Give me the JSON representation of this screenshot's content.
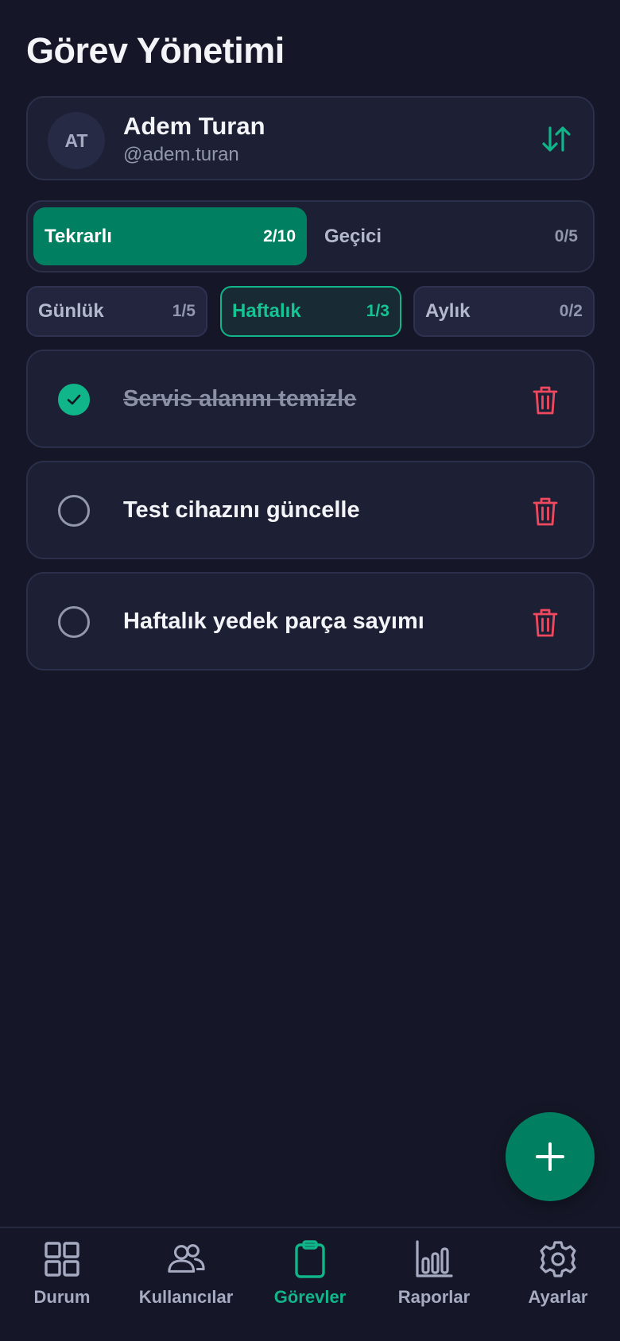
{
  "page": {
    "title": "Görev Yönetimi"
  },
  "user": {
    "initials": "AT",
    "name": "Adem Turan",
    "handle": "@adem.turan"
  },
  "type_tabs": [
    {
      "label": "Tekrarlı",
      "count": "2/10",
      "active": true
    },
    {
      "label": "Geçici",
      "count": "0/5",
      "active": false
    }
  ],
  "period_tabs": [
    {
      "label": "Günlük",
      "count": "1/5",
      "active": false
    },
    {
      "label": "Haftalık",
      "count": "1/3",
      "active": true
    },
    {
      "label": "Aylık",
      "count": "0/2",
      "active": false
    }
  ],
  "tasks": [
    {
      "title": "Servis alanını temizle",
      "completed": true
    },
    {
      "title": "Test cihazını güncelle",
      "completed": false
    },
    {
      "title": "Haftalık yedek parça sayımı",
      "completed": false
    }
  ],
  "fab": {
    "icon": "plus-icon"
  },
  "nav": [
    {
      "label": "Durum",
      "icon": "grid-icon",
      "active": false
    },
    {
      "label": "Kullanıcılar",
      "icon": "users-icon",
      "active": false
    },
    {
      "label": "Görevler",
      "icon": "clipboard-icon",
      "active": true
    },
    {
      "label": "Raporlar",
      "icon": "bar-chart-icon",
      "active": false
    },
    {
      "label": "Ayarlar",
      "icon": "gear-icon",
      "active": false
    }
  ],
  "colors": {
    "background": "#151728",
    "card": "#1d2034",
    "accent": "#10b58a",
    "accent_dark": "#008060",
    "danger": "#f0495f",
    "muted": "#9297ae"
  }
}
